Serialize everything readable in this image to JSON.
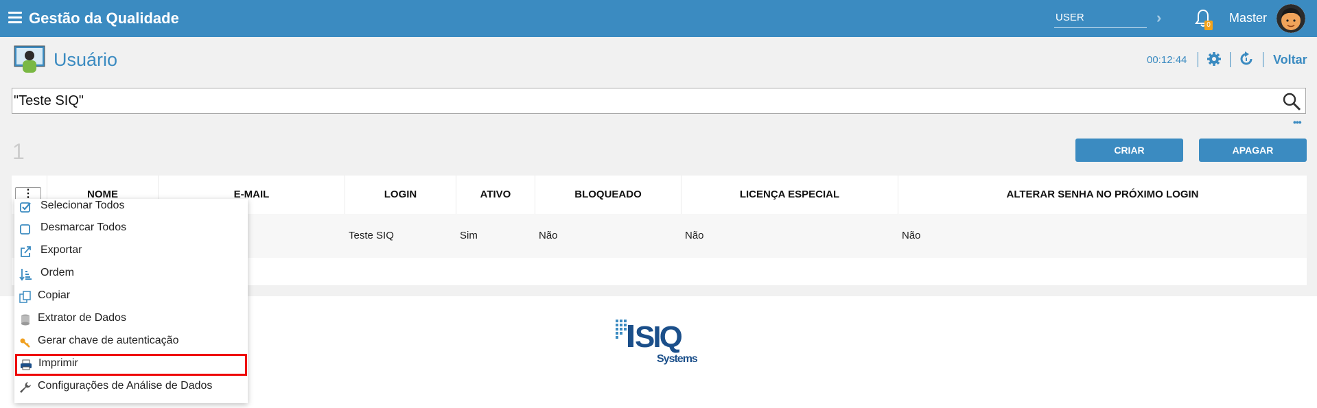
{
  "header": {
    "app_title": "Gestão da Qualidade",
    "user_field_value": "USER",
    "notifications_count": "0",
    "user_name": "Master"
  },
  "page": {
    "title": "Usuário",
    "timer": "00:12:44",
    "back_label": "Voltar"
  },
  "search": {
    "value": "\"Teste SIQ\""
  },
  "results": {
    "count": "1",
    "create_label": "CRIAR",
    "delete_label": "APAGAR"
  },
  "table": {
    "columns": [
      "NOME",
      "E-MAIL",
      "LOGIN",
      "ATIVO",
      "BLOQUEADO",
      "LICENÇA ESPECIAL",
      "ALTERAR SENHA NO PRÓXIMO LOGIN"
    ],
    "rows": [
      {
        "login": "Teste SIQ",
        "ativo": "Sim",
        "bloqueado": "Não",
        "licenca": "Não",
        "alterar_senha": "Não"
      }
    ]
  },
  "menu": {
    "items": [
      {
        "label": "Selecionar Todos",
        "icon": "checkbox-checked-icon"
      },
      {
        "label": "Desmarcar Todos",
        "icon": "checkbox-empty-icon"
      },
      {
        "label": "Exportar",
        "icon": "export-icon"
      },
      {
        "label": "Ordem",
        "icon": "sort-order-icon"
      },
      {
        "label": "Copiar",
        "icon": "copy-icon"
      },
      {
        "label": "Extrator de Dados",
        "icon": "database-icon"
      },
      {
        "label": "Gerar chave de autenticação",
        "icon": "key-icon"
      },
      {
        "label": "Imprimir",
        "icon": "printer-icon"
      },
      {
        "label": "Configurações de Análise de Dados",
        "icon": "wrench-icon"
      }
    ]
  },
  "logo": {
    "name": "SIQ",
    "tagline": "Systems"
  },
  "colors": {
    "primary": "#3b8bc1",
    "badge": "#f3a31a",
    "highlight": "#ee0000"
  }
}
